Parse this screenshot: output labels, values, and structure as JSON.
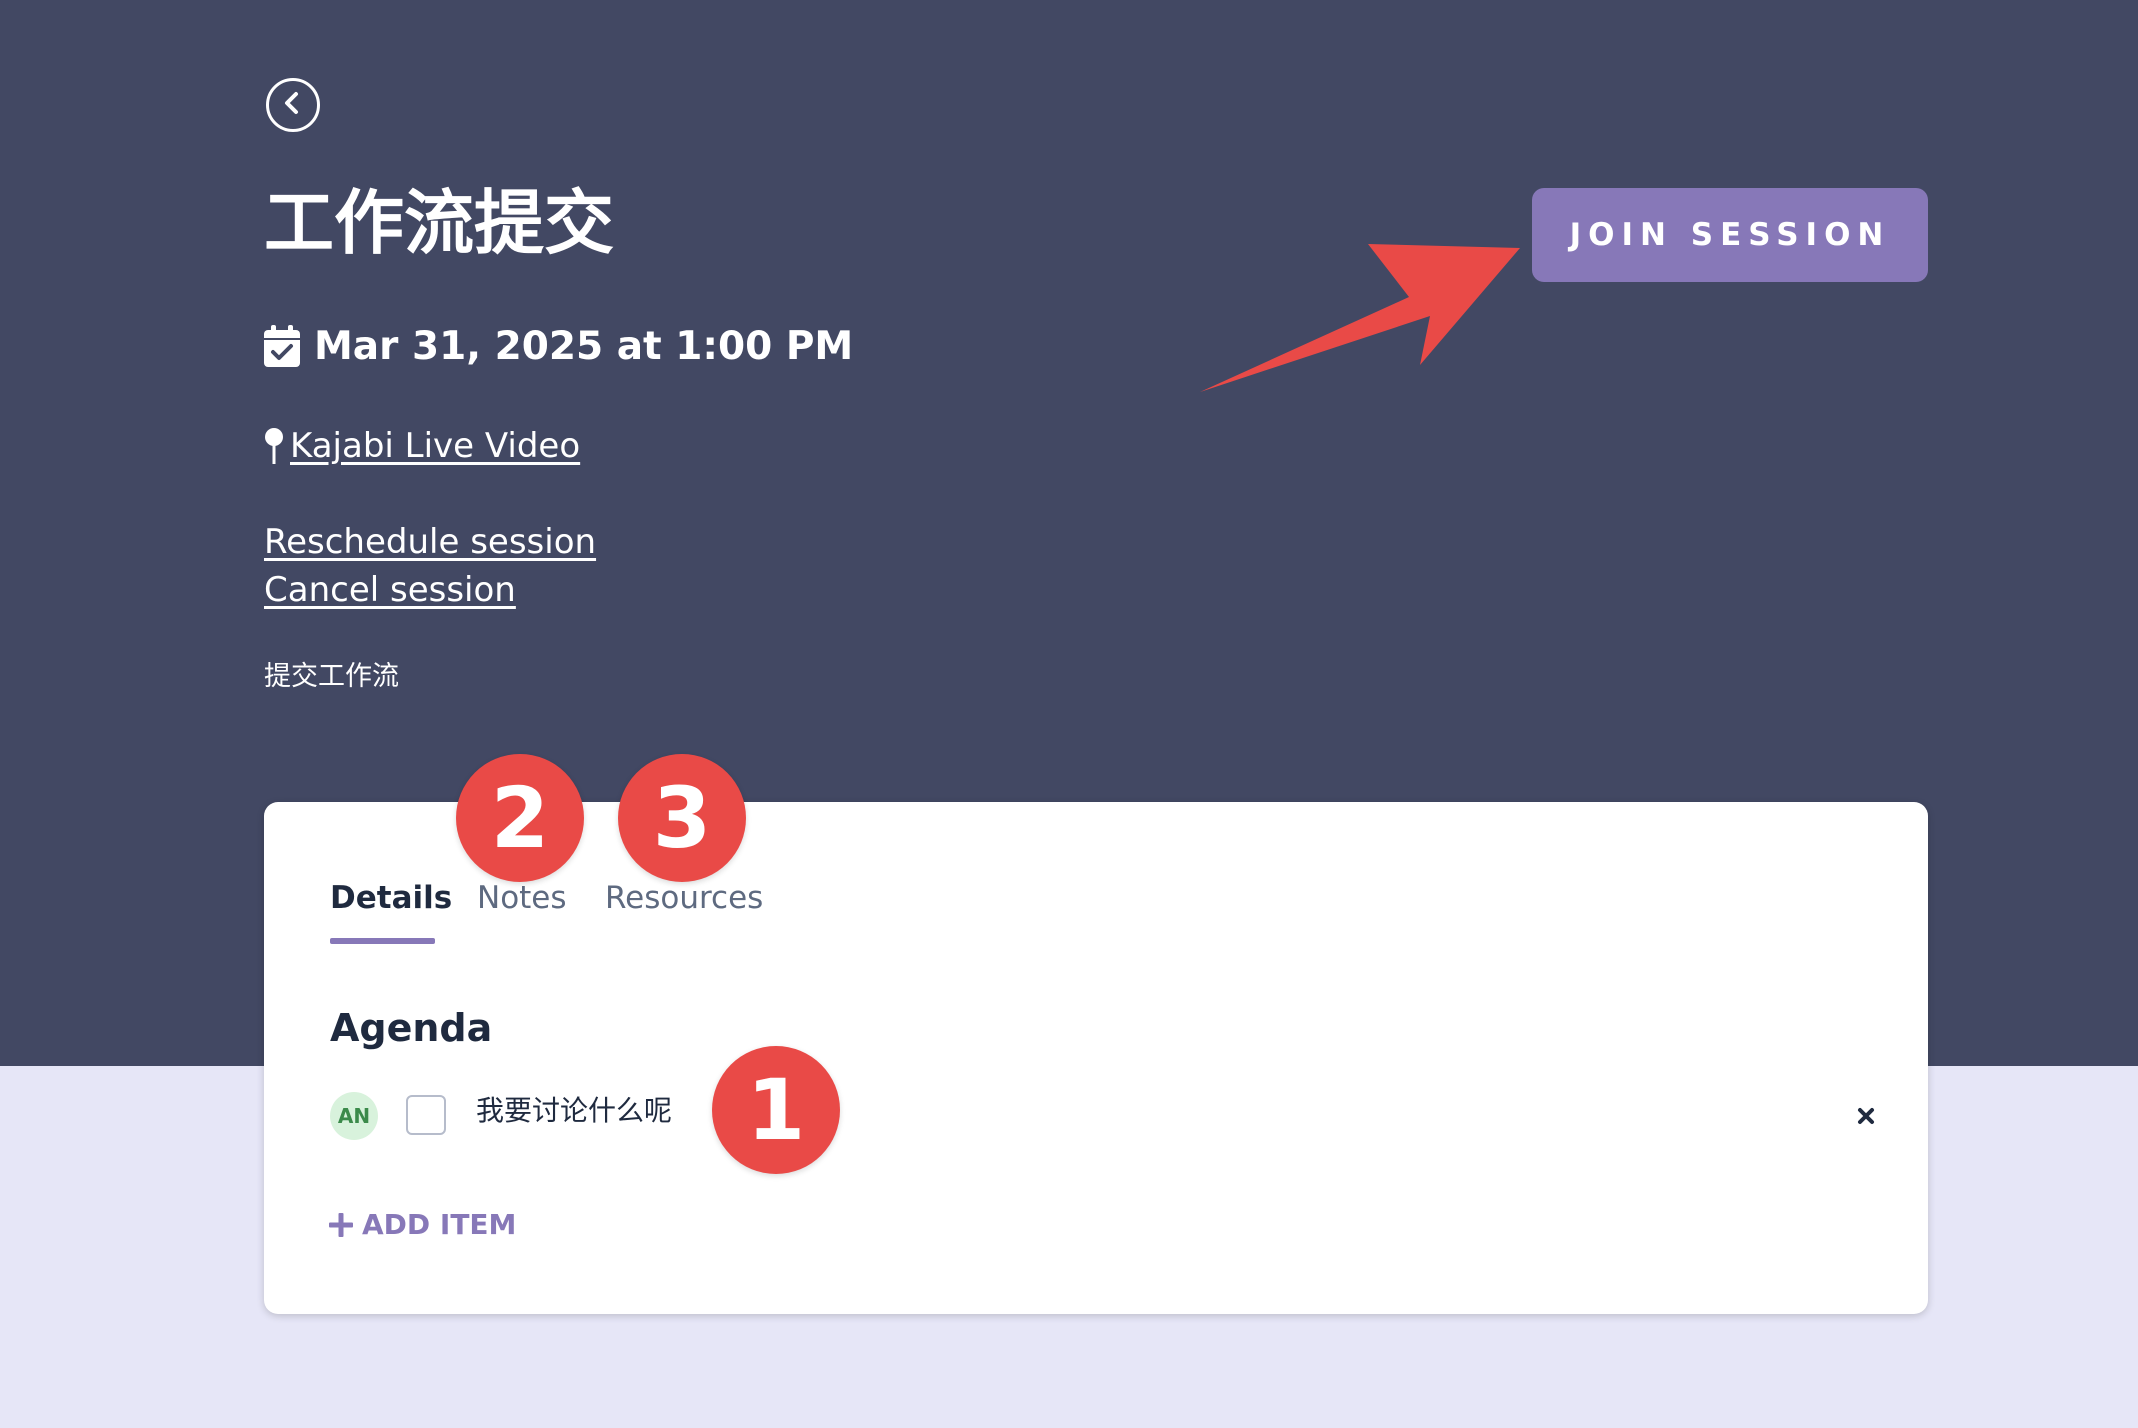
{
  "session": {
    "title": "工作流提交",
    "date": "Mar 31, 2025 at 1:00 PM",
    "location": " Kajabi Live Video",
    "reschedule_label": "Reschedule session",
    "cancel_label": "Cancel session",
    "description": "提交工作流",
    "join_label": "JOIN SESSION"
  },
  "tabs": [
    {
      "label": "Details",
      "active": true
    },
    {
      "label": "Notes",
      "active": false
    },
    {
      "label": "Resources",
      "active": false
    }
  ],
  "agenda": {
    "title": "Agenda",
    "items": [
      {
        "avatar": "AN",
        "text": "我要讨论什么呢",
        "checked": false
      }
    ],
    "add_label": "ADD ITEM"
  },
  "annotations": {
    "badges": [
      "1",
      "2",
      "3"
    ],
    "color": "#e94a47"
  },
  "colors": {
    "hero_background": "#424863",
    "page_background": "#e6e6f7",
    "accent": "#8778b8"
  },
  "icons": [
    "back-chevron-icon",
    "calendar-check-icon",
    "map-pin-icon",
    "close-icon",
    "plus-icon"
  ]
}
